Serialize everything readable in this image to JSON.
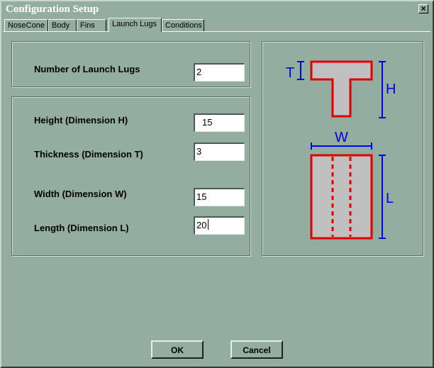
{
  "window": {
    "title": "Configuration Setup",
    "close_glyph": "×"
  },
  "tabs": [
    "NoseCone",
    "Body",
    "Fins",
    "Launch Lugs",
    "Conditions"
  ],
  "active_tab": "Launch Lugs",
  "fields": {
    "num_lugs": {
      "label": "Number of Launch Lugs",
      "value": "2"
    },
    "height": {
      "label": "Height (Dimension H)",
      "value": "15"
    },
    "thickness": {
      "label": "Thickness (Dimension T)",
      "value": "3"
    },
    "width": {
      "label": "Width (Dimension W)",
      "value": "15"
    },
    "length": {
      "label": "Length (Dimension L)",
      "value": "20"
    }
  },
  "diagram": {
    "labels": {
      "t": "T",
      "h": "H",
      "w": "W",
      "l": "L"
    },
    "colors": {
      "outline": "#e00000",
      "dimension": "#0000e0",
      "fill": "#c0c0c0"
    }
  },
  "buttons": {
    "ok": "OK",
    "cancel": "Cancel"
  }
}
